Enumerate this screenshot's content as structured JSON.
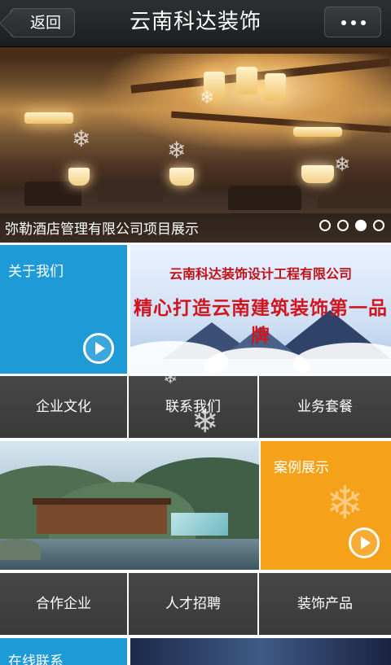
{
  "header": {
    "back_label": "返回",
    "title": "云南科达装饰",
    "more_icon": "more-dots-icon"
  },
  "banner": {
    "caption": "弥勒酒店管理有限公司项目展示",
    "slide_count": 4,
    "active_slide": 3
  },
  "tiles": {
    "about": {
      "label": "关于我们"
    },
    "promo": {
      "line1": "云南科达装饰设计工程有限公司",
      "line2": "精心打造云南建筑装饰第一品牌"
    },
    "row1": [
      "企业文化",
      "联系我们",
      "业务套餐"
    ],
    "cases": {
      "label": "案例展示"
    },
    "row2": [
      "合作企业",
      "人才招聘",
      "装饰产品"
    ],
    "contact": {
      "label": "在线联系"
    }
  },
  "colors": {
    "header_bg": "#222326",
    "blue_tile": "#1e9bd7",
    "orange_tile": "#f6a11a",
    "dark_tile": "#3f3f3f",
    "promo_red": "#d2141e"
  }
}
